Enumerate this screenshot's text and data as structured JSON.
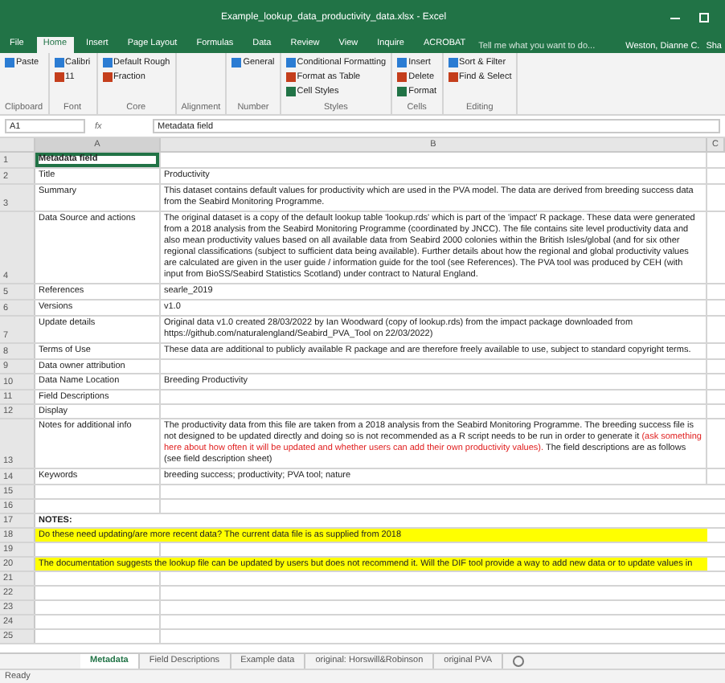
{
  "window": {
    "title": "Example_lookup_data_productivity_data.xlsx - Excel"
  },
  "ribbon_tabs": [
    {
      "label": "File",
      "selected": false
    },
    {
      "label": "Home",
      "selected": true
    },
    {
      "label": "Insert",
      "selected": false
    },
    {
      "label": "Page Layout",
      "selected": false
    },
    {
      "label": "Formulas",
      "selected": false
    },
    {
      "label": "Data",
      "selected": false
    },
    {
      "label": "Review",
      "selected": false
    },
    {
      "label": "View",
      "selected": false
    },
    {
      "label": "Inquire",
      "selected": false
    },
    {
      "label": "ACROBAT",
      "selected": false
    }
  ],
  "tell_me": {
    "placeholder": "Tell me what you want to do..."
  },
  "user": "Weston, Dianne C.",
  "share": "Sha",
  "ribbon_groups": [
    {
      "label": "Clipboard",
      "items": [
        "Paste"
      ]
    },
    {
      "label": "Font",
      "items": [
        "Calibri",
        "11"
      ]
    },
    {
      "label": "Core",
      "items": [
        "Default Rough",
        "Fraction"
      ]
    },
    {
      "label": "Alignment"
    },
    {
      "label": "Number",
      "items": [
        "General"
      ]
    },
    {
      "label": "Styles",
      "items": [
        "Conditional Formatting",
        "Format as Table",
        "Cell Styles"
      ]
    },
    {
      "label": "Cells",
      "items": [
        "Insert",
        "Delete",
        "Format"
      ]
    },
    {
      "label": "Editing",
      "items": [
        "Sort & Filter",
        "Find & Select"
      ]
    }
  ],
  "formula_bar": {
    "name_box": "A1",
    "function_label": "fx",
    "value": "Metadata field"
  },
  "columns": [
    "A",
    "B",
    "C"
  ],
  "rows": [
    {
      "number": "1",
      "kind": "header",
      "field": "Metadata field",
      "selected": true
    },
    {
      "number": "2",
      "kind": "field",
      "field": "Title",
      "value": [
        {
          "kind": "plain",
          "text": "Productivity"
        }
      ],
      "selected": false
    },
    {
      "number": "3",
      "kind": "field",
      "field": "Summary",
      "value": [
        {
          "kind": "plain",
          "text": "This dataset contains default values for productivity which are used in the PVA model. The data are derived from breeding success data from the Seabird Monitoring Programme."
        }
      ],
      "selected": false
    },
    {
      "number": "4",
      "kind": "field",
      "field": "Data Source and actions",
      "value": [
        {
          "kind": "plain",
          "text": "The original dataset is a copy of the default lookup table 'lookup.rds' which is part of the 'impact' R package. These data were generated from a 2018 analysis from the Seabird Monitoring Programme (coordinated by JNCC). The file contains site level productivity data and also mean productivity values based on all available data from Seabird 2000 colonies within the British Isles/global (and for six other regional classifications (subject to sufficient data being available). Further details about how the regional and global productivity values are calculated are given in the user guide / information guide for the tool (see References). The PVA tool was produced by CEH (with input from BioSS/Seabird Statistics Scotland) under contract to Natural England."
        }
      ],
      "selected": false
    },
    {
      "number": "5",
      "kind": "field",
      "field": "References",
      "value": [
        {
          "kind": "plain",
          "text": "searle_2019"
        }
      ],
      "selected": false
    },
    {
      "number": "6",
      "kind": "field",
      "field": "Versions",
      "value": [
        {
          "kind": "plain",
          "text": "v1.0"
        }
      ],
      "selected": false
    },
    {
      "number": "7",
      "kind": "field",
      "field": "Update details",
      "value": [
        {
          "kind": "plain",
          "text": "Original data v1.0 created 28/03/2022 by Ian Woodward (copy of lookup.rds) from the impact package downloaded from https://github.com/naturalengland/Seabird_PVA_Tool on 22/03/2022)"
        }
      ],
      "selected": false
    },
    {
      "number": "8",
      "kind": "field",
      "field": "Terms of Use",
      "value": [
        {
          "kind": "plain",
          "text": "These data are additional to publicly available R package and are therefore freely available to use, subject to standard copyright terms."
        }
      ],
      "selected": false
    },
    {
      "number": "9",
      "kind": "field",
      "field": "Data owner attribution",
      "selected": false
    },
    {
      "number": "10",
      "kind": "field",
      "field": "Data Name Location",
      "value": [
        {
          "kind": "plain",
          "text": "Breeding Productivity"
        }
      ],
      "selected": false
    },
    {
      "number": "11",
      "kind": "field",
      "field": "Field Descriptions",
      "selected": false
    },
    {
      "number": "12",
      "kind": "field",
      "field": "Display",
      "selected": false
    },
    {
      "number": "13",
      "kind": "field",
      "field": "Notes for additional info",
      "value": [
        {
          "kind": "plain",
          "text": "The productivity data from this file are taken from a 2018 analysis from the Seabird Monitoring Programme. The breeding success file is not designed to be updated directly and doing so is not recommended as a R script needs to be run in order to generate it "
        },
        {
          "kind": "flagged",
          "text": "(ask something here about how often it will be updated and whether users can add their own productivity values)."
        },
        {
          "kind": "plain",
          "text": " The field descriptions are as follows (see field description sheet)"
        }
      ],
      "selected": false
    },
    {
      "number": "14",
      "kind": "field",
      "field": "Keywords",
      "value": [
        {
          "kind": "plain",
          "text": "breeding success; productivity; PVA tool; nature"
        }
      ],
      "selected": false
    },
    {
      "number": "15",
      "kind": "blank",
      "selected": false
    },
    {
      "number": "16",
      "kind": "blank",
      "selected": false
    },
    {
      "number": "17",
      "kind": "notes_title",
      "field": "NOTES:",
      "selected": false
    },
    {
      "number": "18",
      "kind": "note",
      "field": "Do these need updating/are more recent data? The current data file is as supplied from 2018",
      "selected": false
    },
    {
      "number": "19",
      "kind": "blank",
      "selected": false
    },
    {
      "number": "20",
      "kind": "note",
      "field": "The documentation suggests the lookup file can be updated by users but does not recommend it. Will the DIF tool provide a way to add new data or to update values in",
      "selected": false
    },
    {
      "number": "21",
      "kind": "blank",
      "selected": false
    },
    {
      "number": "22",
      "kind": "blank",
      "selected": false
    },
    {
      "number": "23",
      "kind": "blank",
      "selected": false
    },
    {
      "number": "24",
      "kind": "blank",
      "selected": false
    },
    {
      "number": "25",
      "kind": "blank",
      "selected": false
    }
  ],
  "sheet_tabs": [
    {
      "label": "Metadata",
      "selected": true
    },
    {
      "label": "Field Descriptions",
      "selected": false
    },
    {
      "label": "Example data",
      "selected": false
    },
    {
      "label": "original: Horswill&Robinson",
      "selected": false
    },
    {
      "label": "original PVA",
      "selected": false
    }
  ],
  "status_bar": {
    "text": "Ready"
  }
}
